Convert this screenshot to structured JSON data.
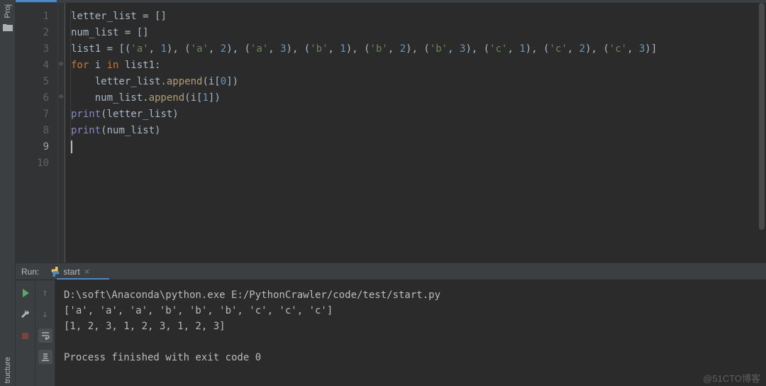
{
  "sidebar": {
    "project_label": "Proj",
    "structure_label": "tructure"
  },
  "editor": {
    "lines": [
      {
        "n": "1",
        "tokens": [
          [
            "id",
            "letter_list "
          ],
          [
            "op",
            "= "
          ],
          [
            "punct",
            "[]"
          ]
        ]
      },
      {
        "n": "2",
        "tokens": [
          [
            "id",
            "num_list "
          ],
          [
            "op",
            "= "
          ],
          [
            "punct",
            "[]"
          ]
        ]
      },
      {
        "n": "3",
        "tokens": [
          [
            "id",
            "list1 "
          ],
          [
            "op",
            "= "
          ],
          [
            "punct",
            "[("
          ],
          [
            "str",
            "'a'"
          ],
          [
            "punct",
            ", "
          ],
          [
            "num",
            "1"
          ],
          [
            "punct",
            "), ("
          ],
          [
            "str",
            "'a'"
          ],
          [
            "punct",
            ", "
          ],
          [
            "num",
            "2"
          ],
          [
            "punct",
            "), ("
          ],
          [
            "str",
            "'a'"
          ],
          [
            "punct",
            ", "
          ],
          [
            "num",
            "3"
          ],
          [
            "punct",
            "), ("
          ],
          [
            "str",
            "'b'"
          ],
          [
            "punct",
            ", "
          ],
          [
            "num",
            "1"
          ],
          [
            "punct",
            "), ("
          ],
          [
            "str",
            "'b'"
          ],
          [
            "punct",
            ", "
          ],
          [
            "num",
            "2"
          ],
          [
            "punct",
            "), ("
          ],
          [
            "str",
            "'b'"
          ],
          [
            "punct",
            ", "
          ],
          [
            "num",
            "3"
          ],
          [
            "punct",
            "), ("
          ],
          [
            "str",
            "'c'"
          ],
          [
            "punct",
            ", "
          ],
          [
            "num",
            "1"
          ],
          [
            "punct",
            "), ("
          ],
          [
            "str",
            "'c'"
          ],
          [
            "punct",
            ", "
          ],
          [
            "num",
            "2"
          ],
          [
            "punct",
            "), ("
          ],
          [
            "str",
            "'c'"
          ],
          [
            "punct",
            ", "
          ],
          [
            "num",
            "3"
          ],
          [
            "punct",
            ")]"
          ]
        ]
      },
      {
        "n": "4",
        "tokens": [
          [
            "kw",
            "for "
          ],
          [
            "id",
            "i "
          ],
          [
            "kw",
            "in "
          ],
          [
            "id",
            "list1"
          ],
          [
            "punct",
            ":"
          ]
        ]
      },
      {
        "n": "5",
        "indent": "    ",
        "tokens": [
          [
            "id",
            "letter_list."
          ],
          [
            "fn",
            "append"
          ],
          [
            "punct",
            "(i["
          ],
          [
            "num",
            "0"
          ],
          [
            "punct",
            "])"
          ]
        ]
      },
      {
        "n": "6",
        "indent": "    ",
        "tokens": [
          [
            "id",
            "num_list."
          ],
          [
            "fn",
            "append"
          ],
          [
            "punct",
            "(i["
          ],
          [
            "num",
            "1"
          ],
          [
            "punct",
            "])"
          ]
        ]
      },
      {
        "n": "7",
        "tokens": [
          [
            "builtin",
            "print"
          ],
          [
            "punct",
            "(letter_list)"
          ]
        ]
      },
      {
        "n": "8",
        "tokens": [
          [
            "builtin",
            "print"
          ],
          [
            "punct",
            "(num_list)"
          ]
        ]
      },
      {
        "n": "9",
        "cursor": true,
        "tokens": []
      },
      {
        "n": "10",
        "tokens": []
      }
    ],
    "fold_markers": [
      {
        "line": 4,
        "glyph": "⊖"
      },
      {
        "line": 6,
        "glyph": "⊖"
      }
    ],
    "current_line": "9"
  },
  "run": {
    "panel_label": "Run:",
    "tab_name": "start",
    "icons": {
      "play": "play-icon",
      "wrench": "wrench-icon",
      "stop": "stop-icon",
      "up": "arrow-up-icon",
      "down": "arrow-down-icon",
      "soft_wrap": "soft-wrap-icon",
      "scroll_end": "scroll-to-end-icon"
    },
    "output": [
      "D:\\soft\\Anaconda\\python.exe E:/PythonCrawler/code/test/start.py",
      "['a', 'a', 'a', 'b', 'b', 'b', 'c', 'c', 'c']",
      "[1, 2, 3, 1, 2, 3, 1, 2, 3]",
      "",
      "Process finished with exit code 0"
    ]
  },
  "watermark": "@51CTO博客"
}
